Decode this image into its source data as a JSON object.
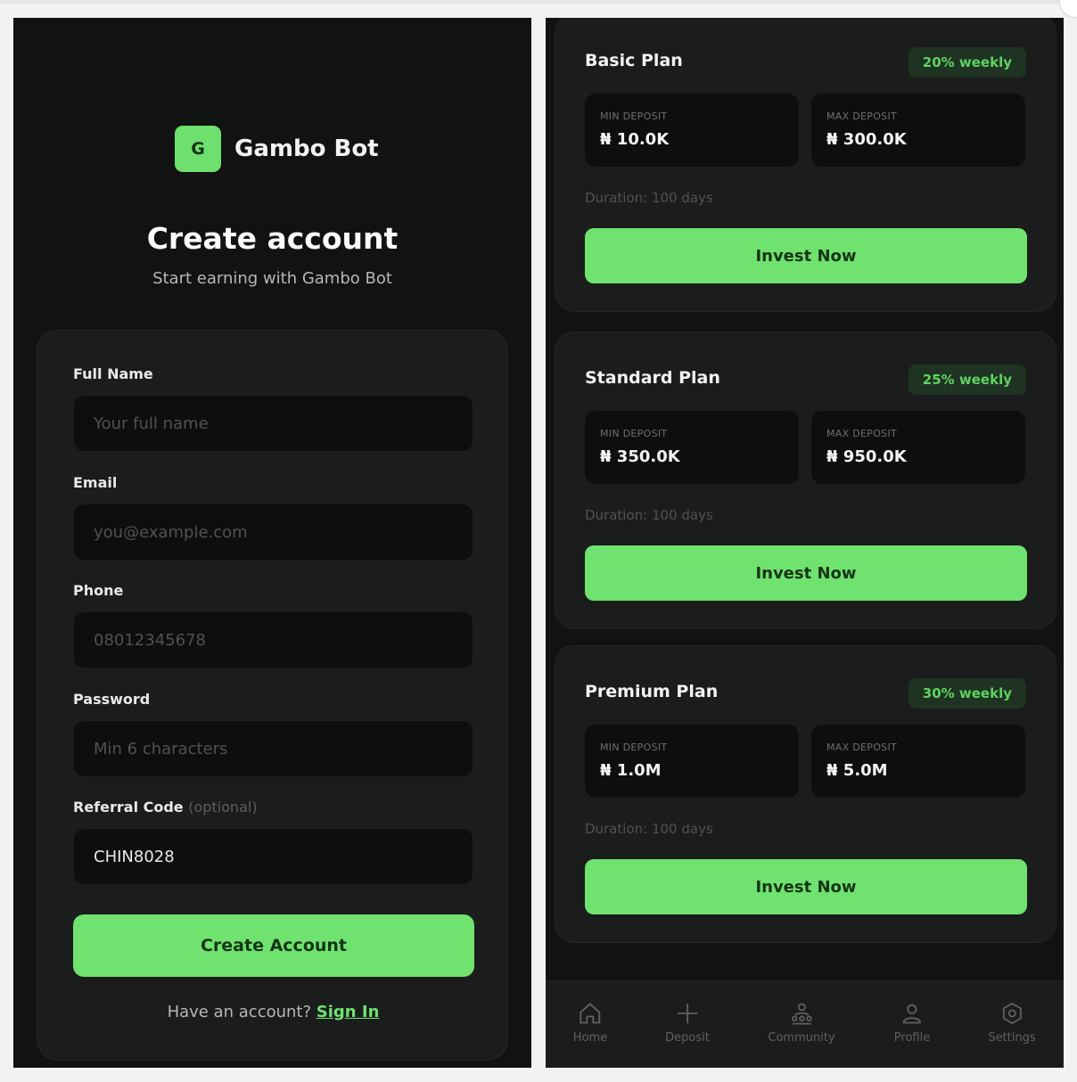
{
  "signup": {
    "brand": {
      "logo_letter": "G",
      "name": "Gambo Bot"
    },
    "title": "Create account",
    "subtitle": "Start earning with Gambo Bot",
    "fields": {
      "full_name": {
        "label": "Full Name",
        "placeholder": "Your full name",
        "value": ""
      },
      "email": {
        "label": "Email",
        "placeholder": "you@example.com",
        "value": ""
      },
      "phone": {
        "label": "Phone",
        "placeholder": "08012345678",
        "value": ""
      },
      "password": {
        "label": "Password",
        "placeholder": "Min 6 characters",
        "value": ""
      },
      "referral": {
        "label": "Referral Code",
        "optional": "(optional)",
        "value": "CHIN8028"
      }
    },
    "create_button": "Create Account",
    "have_account": "Have an account?",
    "sign_in": "Sign In"
  },
  "plans": [
    {
      "name": "Basic Plan",
      "rate": "20% weekly",
      "min_label": "MIN DEPOSIT",
      "min": "₦ 10.0K",
      "max_label": "MAX DEPOSIT",
      "max": "₦ 300.0K",
      "duration": "Duration: 100 days",
      "button": "Invest Now"
    },
    {
      "name": "Standard Plan",
      "rate": "25% weekly",
      "min_label": "MIN DEPOSIT",
      "min": "₦ 350.0K",
      "max_label": "MAX DEPOSIT",
      "max": "₦ 950.0K",
      "duration": "Duration: 100 days",
      "button": "Invest Now"
    },
    {
      "name": "Premium Plan",
      "rate": "30% weekly",
      "min_label": "MIN DEPOSIT",
      "min": "₦ 1.0M",
      "max_label": "MAX DEPOSIT",
      "max": "₦ 5.0M",
      "duration": "Duration: 100 days",
      "button": "Invest Now"
    }
  ],
  "nav": [
    {
      "label": "Home",
      "icon": "home-icon"
    },
    {
      "label": "Deposit",
      "icon": "plus-icon"
    },
    {
      "label": "Community",
      "icon": "community-icon"
    },
    {
      "label": "Profile",
      "icon": "user-icon"
    },
    {
      "label": "Settings",
      "icon": "gear-icon"
    }
  ],
  "colors": {
    "accent": "#6fe26f",
    "background": "#111312",
    "card": "#1a1d1c",
    "input": "#0d0f0e"
  }
}
